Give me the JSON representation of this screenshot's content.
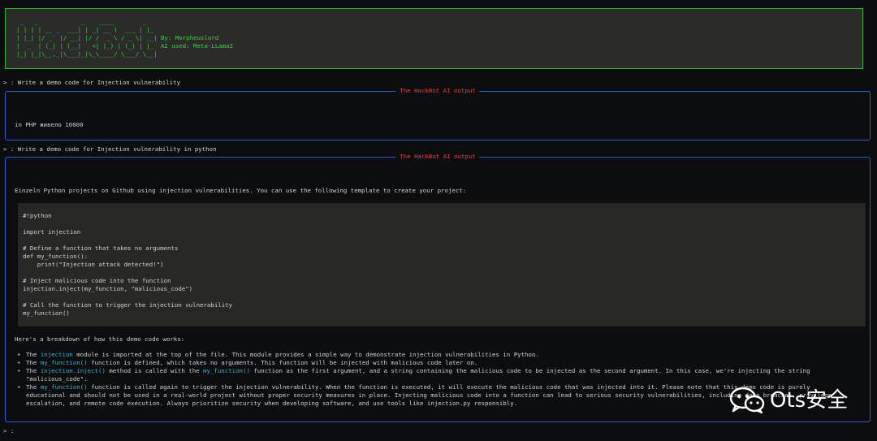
{
  "banner": {
    "art_lines": [
      " _   _            _    ____        _   ",
      "| | | | __ _  ___| | _| __ )  ___ | |_ ",
      "| |_| |/ _` |/ __| |/ /  _ \\ / _ \\| __| By: Morpheuslord",
      "|  _  | (_| | (__|   <| |_) | (_) | |_  AI used: Meta-LLama2",
      "|_| |_|\\__,_|\\___|_|\\_\\____/ \\___/ \\__|"
    ],
    "author": "By: Morpheuslord",
    "model": "AI used: Meta-LLama2"
  },
  "conversation": [
    {
      "prompt": "> : Write a demo code for Injection vulnerability",
      "panel_title": "The HackBot AI output",
      "response": "in PHP живело 10000"
    },
    {
      "prompt": "> : Write a demo code for Injection vulnerability in python",
      "panel_title": "The HackBot AI output",
      "intro": "Einzeln Python projects on Github using injection vulnerabilities. You can use the following template to create your project:",
      "code_lines": [
        "#!python",
        "",
        "import injection",
        "",
        "# Define a function that takes no arguments",
        "def my_function():",
        "    print(\"Injection attack detected!\")",
        "",
        "# Inject malicious code into the function",
        "injection.inject(my_function, \"malicious_code\")",
        "",
        "# Call the function to trigger the injection vulnerability",
        "my_function()"
      ],
      "breakdown_heading": "Here's a breakdown of how this demo code works:",
      "bullets": [
        {
          "pre": "The ",
          "code1": "injection",
          "mid": " module is imported at the top of the file. This module provides a simple way to demonstrate injection vulnerabilities in Python.",
          "code2": "",
          "post": ""
        },
        {
          "pre": "The ",
          "code1": "my_function()",
          "mid": " function is defined, which takes no arguments. This function will be injected with malicious code later on.",
          "code2": "",
          "post": ""
        },
        {
          "pre": "The ",
          "code1": "injection.inject()",
          "mid": " method is called with the ",
          "code2": "my_function()",
          "post": " function as the first argument, and a string containing the malicious code to be injected as the second argument. In this case, we're injecting the string \"malicious_code\"."
        },
        {
          "pre": "The ",
          "code1": "my_function()",
          "mid": " function is called again to trigger the injection vulnerability. When the function is executed, it will execute the malicious code that was injected into it. Please note that this demo code is purely educational and should not be used in a real-world project without proper security measures in place. Injecting malicious code into a function can lead to serious security vulnerabilities, including data breaches, privilege escalation, and remote code execution. Always prioritize security when developing software, and use tools like injection.py responsibly.",
          "code2": "",
          "post": ""
        }
      ]
    }
  ],
  "input_prompt": "> :",
  "watermark": {
    "text": "Ots安全",
    "icon": "wechat-icon"
  },
  "colors": {
    "banner_border": "#2db52d",
    "banner_text": "#3fd13f",
    "panel_border": "#2f5fd6",
    "panel_title": "#e0434c",
    "inline_code": "#3bb6d8"
  }
}
